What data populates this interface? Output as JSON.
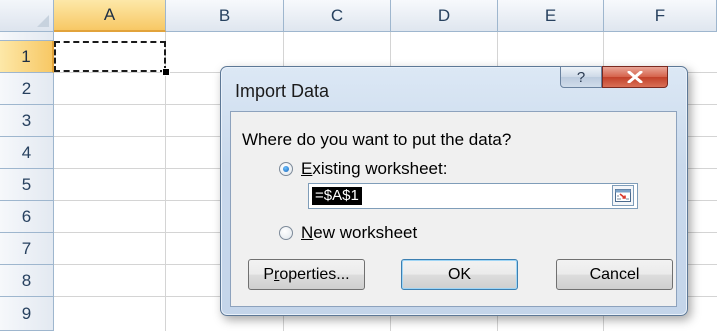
{
  "spreadsheet": {
    "columns": [
      "A",
      "B",
      "C",
      "D",
      "E",
      "F"
    ],
    "rows": [
      "1",
      "2",
      "3",
      "4",
      "5",
      "6",
      "7",
      "8",
      "9"
    ],
    "active_column": "A",
    "active_row": "1"
  },
  "dialog": {
    "title": "Import Data",
    "help_glyph": "?",
    "prompt": "Where do you want to put the data?",
    "existing_worksheet": {
      "accel": "E",
      "rest": "xisting worksheet:",
      "selected": true
    },
    "cell_reference": "=$A$1",
    "new_worksheet": {
      "accel": "N",
      "rest": "ew worksheet",
      "selected": false
    },
    "buttons": {
      "properties_accel": "r",
      "properties_pre": "P",
      "properties_post": "operties...",
      "ok": "OK",
      "cancel": "Cancel"
    }
  },
  "colors": {
    "active_header": "#f7c865",
    "close_button": "#c2412a",
    "title_bar": "#c9d9ec"
  },
  "icons": {
    "help": "help-icon",
    "close": "close-icon",
    "collapse": "collapse-dialog-icon",
    "radio_on": "radio-selected-icon",
    "radio_off": "radio-unselected-icon"
  }
}
